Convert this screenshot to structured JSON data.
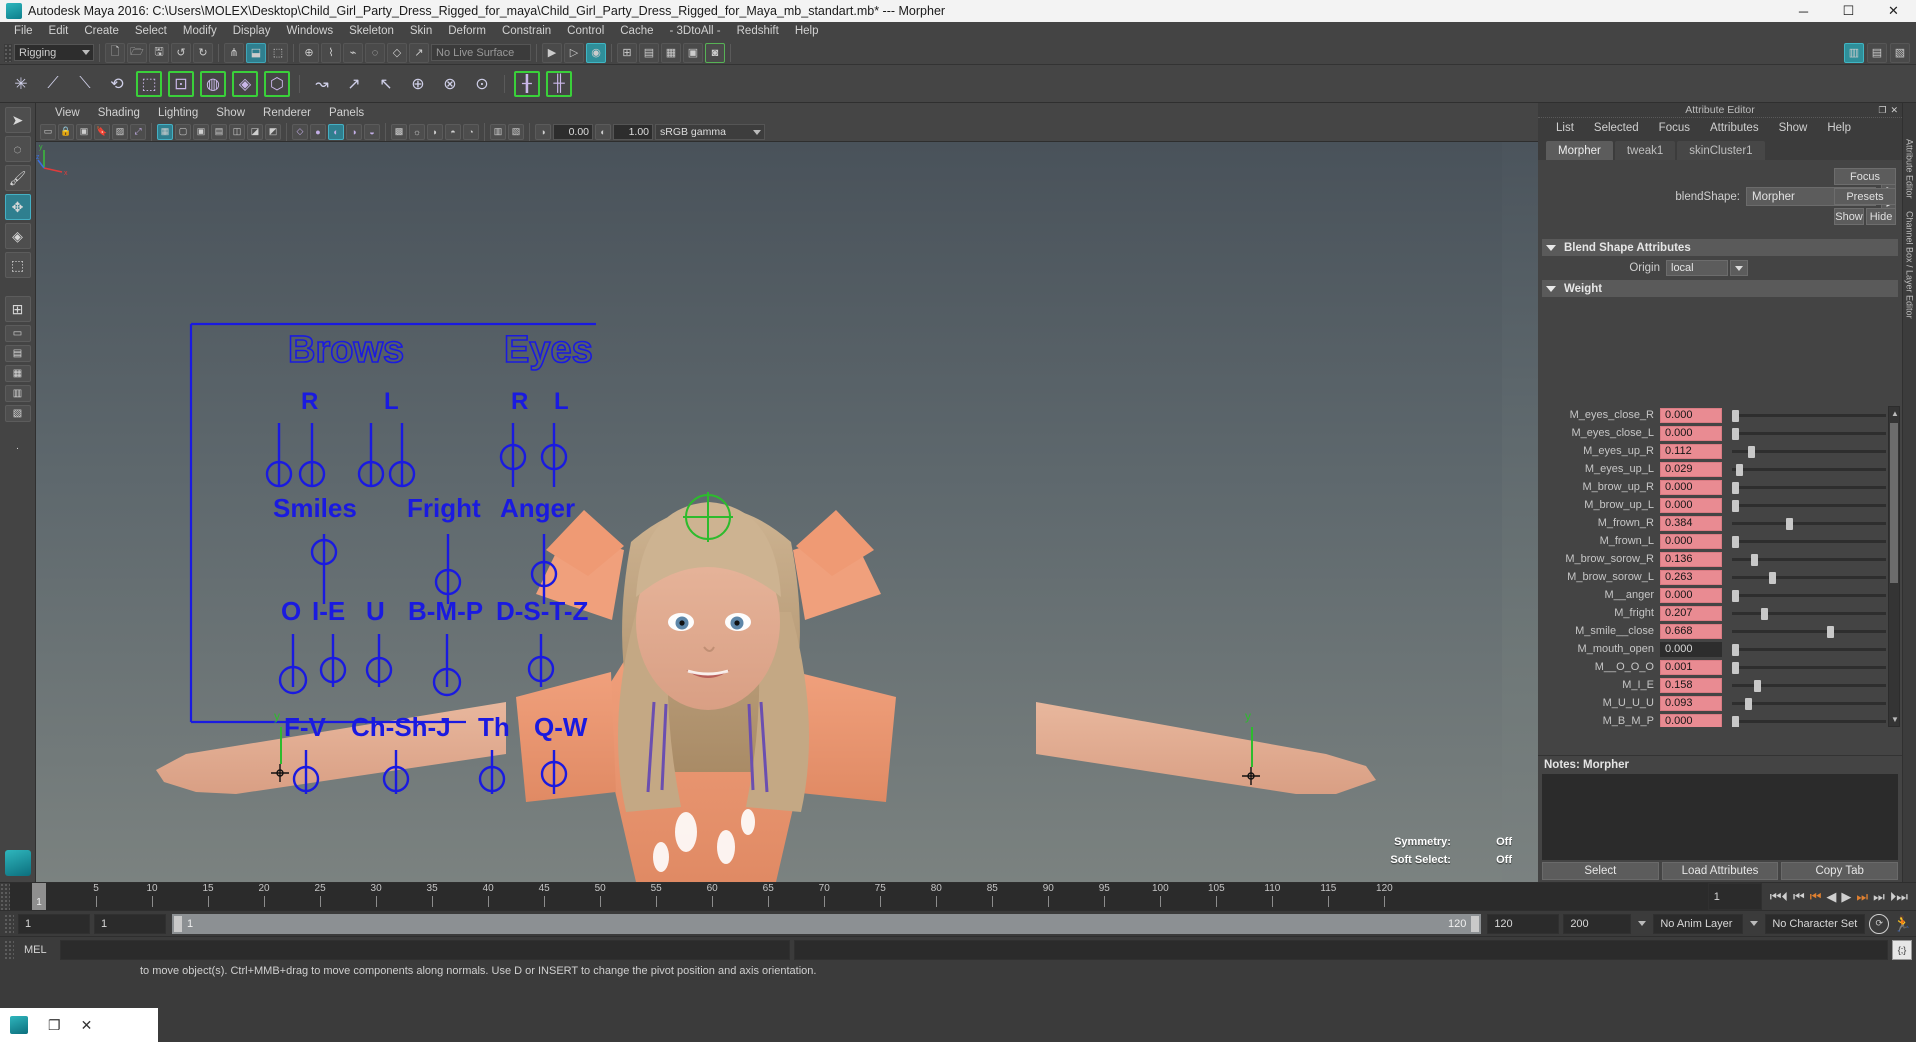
{
  "window": {
    "title": "Autodesk Maya 2016: C:\\Users\\MOLEX\\Desktop\\Child_Girl_Party_Dress_Rigged_for_maya\\Child_Girl_Party_Dress_Rigged_for_Maya_mb_standart.mb*  ---  Morpher",
    "minimize": "─",
    "maximize": "☐",
    "close": "✕",
    "app_icon": "maya-logo-icon"
  },
  "menubar": [
    "File",
    "Edit",
    "Create",
    "Select",
    "Modify",
    "Display",
    "Windows",
    "Skeleton",
    "Skin",
    "Deform",
    "Constrain",
    "Control",
    "Cache",
    "- 3DtoAll -",
    "Redshift",
    "Help"
  ],
  "statusbar": {
    "menuset": "Rigging",
    "live_surface": "No Live Surface"
  },
  "toolbox": {
    "items": [
      "select-tool",
      "lasso-select-tool",
      "paint-select-tool",
      "move-tool",
      "rotate-tool",
      "scale-tool",
      "last-tool",
      "snap-grid",
      "snap-curve",
      "snap-point",
      "snap-view",
      "snap-normal",
      "more-tools"
    ]
  },
  "viewport": {
    "menu": [
      "View",
      "Shading",
      "Lighting",
      "Show",
      "Renderer",
      "Panels"
    ],
    "exposure": "0.00",
    "gamma_value": "1.00",
    "color_space": "sRGB gamma",
    "hud": {
      "symmetry_label": "Symmetry:",
      "symmetry_value": "Off",
      "soft_select_label": "Soft Select:",
      "soft_select_value": "Off"
    },
    "axis_labels": {
      "x": "x",
      "y": "y",
      "z": "z"
    },
    "rig_overlay": {
      "color": "#1a1ae0",
      "groups": [
        {
          "title": "Brows",
          "sub": [
            "R",
            "L"
          ]
        },
        {
          "title": "Eyes",
          "sub": [
            "R",
            "L"
          ]
        },
        {
          "title": "Smiles",
          "sub": []
        },
        {
          "title": "Fright",
          "sub": []
        },
        {
          "title": "Anger",
          "sub": []
        },
        {
          "title": "O",
          "sub": []
        },
        {
          "title": "I-E",
          "sub": []
        },
        {
          "title": "U",
          "sub": []
        },
        {
          "title": "B-M-P",
          "sub": []
        },
        {
          "title": "D-S-T-Z",
          "sub": []
        },
        {
          "title": "F-V",
          "sub": []
        },
        {
          "title": "Ch-Sh-J",
          "sub": []
        },
        {
          "title": "Th",
          "sub": []
        },
        {
          "title": "Q-W",
          "sub": []
        }
      ]
    },
    "manip_labels": {
      "left_y": "y",
      "right_y": "y"
    }
  },
  "attribute_editor": {
    "panel_title": "Attribute Editor",
    "menu": [
      "List",
      "Selected",
      "Focus",
      "Attributes",
      "Show",
      "Help"
    ],
    "tabs": [
      {
        "label": "Morpher",
        "active": true
      },
      {
        "label": "tweak1",
        "active": false
      },
      {
        "label": "skinCluster1",
        "active": false
      }
    ],
    "blendshape_label": "blendShape:",
    "blendshape_value": "Morpher",
    "side_buttons": {
      "focus": "Focus",
      "presets": "Presets",
      "show": "Show",
      "hide": "Hide"
    },
    "sections": {
      "blend_shape_attributes": "Blend Shape Attributes",
      "origin_label": "Origin",
      "origin_value": "local",
      "weight": "Weight"
    },
    "weights": [
      {
        "name": "M_eyes_close_R",
        "value": "0.000",
        "pos": 0.0,
        "keyed": true
      },
      {
        "name": "M_eyes_close_L",
        "value": "0.000",
        "pos": 0.0,
        "keyed": true
      },
      {
        "name": "M_eyes_up_R",
        "value": "0.112",
        "pos": 0.112,
        "keyed": true
      },
      {
        "name": "M_eyes_up_L",
        "value": "0.029",
        "pos": 0.029,
        "keyed": true
      },
      {
        "name": "M_brow_up_R",
        "value": "0.000",
        "pos": 0.0,
        "keyed": true
      },
      {
        "name": "M_brow_up_L",
        "value": "0.000",
        "pos": 0.0,
        "keyed": true
      },
      {
        "name": "M_frown_R",
        "value": "0.384",
        "pos": 0.384,
        "keyed": true
      },
      {
        "name": "M_frown_L",
        "value": "0.000",
        "pos": 0.0,
        "keyed": true
      },
      {
        "name": "M_brow_sorow_R",
        "value": "0.136",
        "pos": 0.136,
        "keyed": true
      },
      {
        "name": "M_brow_sorow_L",
        "value": "0.263",
        "pos": 0.263,
        "keyed": true
      },
      {
        "name": "M__anger",
        "value": "0.000",
        "pos": 0.0,
        "keyed": true
      },
      {
        "name": "M_fright",
        "value": "0.207",
        "pos": 0.207,
        "keyed": true
      },
      {
        "name": "M_smile__close",
        "value": "0.668",
        "pos": 0.668,
        "keyed": true
      },
      {
        "name": "M_mouth_open",
        "value": "0.000",
        "pos": 0.0,
        "keyed": false
      },
      {
        "name": "M__O_O_O",
        "value": "0.001",
        "pos": 0.001,
        "keyed": true
      },
      {
        "name": "M_I_E",
        "value": "0.158",
        "pos": 0.158,
        "keyed": true
      },
      {
        "name": "M_U_U_U",
        "value": "0.093",
        "pos": 0.093,
        "keyed": true
      },
      {
        "name": "M_B_M_P",
        "value": "0.000",
        "pos": 0.0,
        "keyed": true
      }
    ],
    "notes_label": "Notes:",
    "notes_value": "Morpher",
    "notes_text": "",
    "buttons": [
      "Select",
      "Load Attributes",
      "Copy Tab"
    ]
  },
  "right_vertical_tabs": [
    "Attribute Editor",
    "Channel Box / Layer Editor"
  ],
  "timeline": {
    "tick_labels": [
      "5",
      "10",
      "15",
      "20",
      "25",
      "30",
      "35",
      "40",
      "45",
      "50",
      "55",
      "60",
      "65",
      "70",
      "75",
      "80",
      "85",
      "90",
      "95",
      "100",
      "105",
      "110",
      "115",
      "120"
    ],
    "current_frame": "1",
    "current_frame_field": "1",
    "range_start": "1",
    "range_end": "1",
    "range_slider_start": "1",
    "range_slider_end": "120",
    "anim_end": "120",
    "playback_end": "200",
    "anim_layer": "No Anim Layer",
    "character_set": "No Character Set",
    "playback_buttons": [
      "go-to-start",
      "step-back-key",
      "step-back-frame",
      "play-backwards",
      "play-forwards",
      "step-forward-frame",
      "step-forward-key",
      "go-to-end"
    ]
  },
  "command_line": {
    "language": "MEL",
    "input": "",
    "output": ""
  },
  "helpline": "to move object(s). Ctrl+MMB+drag to move components along normals. Use D or INSERT to change the pivot position and axis orientation.",
  "taskbar": {
    "items": [
      "maya-taskbar-icon",
      "restore-icon",
      "close-icon"
    ]
  }
}
